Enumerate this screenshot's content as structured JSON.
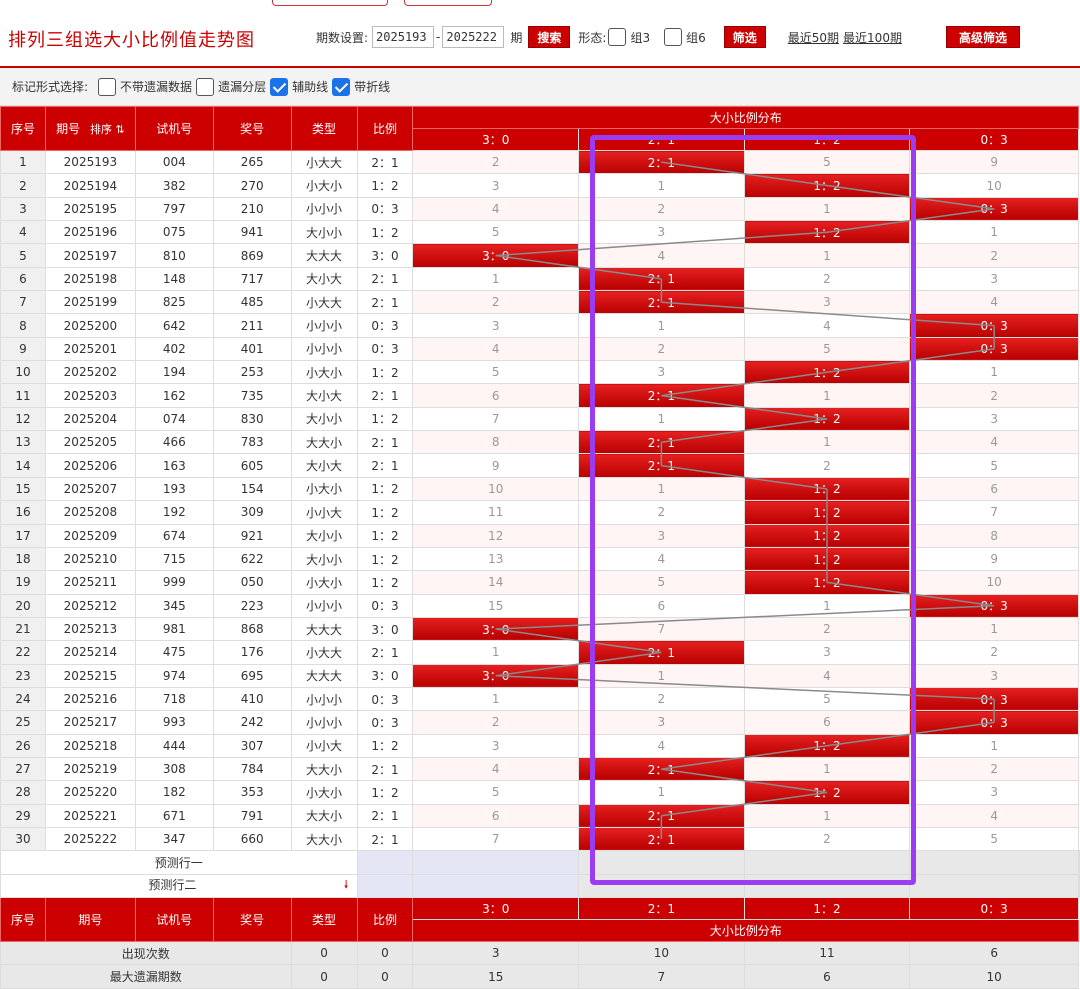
{
  "header": {
    "title": "排列三组选大小比例值走势图",
    "period_label": "期数设置:",
    "period_from": "2025193",
    "period_to": "2025222",
    "period_suffix": "期",
    "search_label": "搜索",
    "form_label": "形态:",
    "group3_label": "组3",
    "group6_label": "组6",
    "filter_label": "筛选",
    "recent50": "最近50期",
    "recent100": "最近100期",
    "advanced_label": "高级筛选"
  },
  "markers": {
    "label": "标记形式选择:",
    "options": [
      {
        "label": "不带遗漏数据",
        "checked": false
      },
      {
        "label": "遗漏分层",
        "checked": false
      },
      {
        "label": "辅助线",
        "checked": true
      },
      {
        "label": "带折线",
        "checked": true
      }
    ]
  },
  "columns": {
    "idx": "序号",
    "period": "期号",
    "sort": "排序",
    "test": "试机号",
    "prize": "奖号",
    "type": "类型",
    "ratio": "比例",
    "dist_title": "大小比例分布",
    "dist": [
      "3：0",
      "2：1",
      "1：2",
      "0：3"
    ]
  },
  "rows": [
    {
      "idx": "1",
      "period": "2025193",
      "test": "004",
      "prize": "265",
      "type": "小大大",
      "ratio": "2：1",
      "dist": [
        "2",
        "2：1",
        "5",
        "9"
      ]
    },
    {
      "idx": "2",
      "period": "2025194",
      "test": "382",
      "prize": "270",
      "type": "小大小",
      "ratio": "1：2",
      "dist": [
        "3",
        "1",
        "1：2",
        "10"
      ]
    },
    {
      "idx": "3",
      "period": "2025195",
      "test": "797",
      "prize": "210",
      "type": "小小小",
      "ratio": "0：3",
      "dist": [
        "4",
        "2",
        "1",
        "0：3"
      ]
    },
    {
      "idx": "4",
      "period": "2025196",
      "test": "075",
      "prize": "941",
      "type": "大小小",
      "ratio": "1：2",
      "dist": [
        "5",
        "3",
        "1：2",
        "1"
      ]
    },
    {
      "idx": "5",
      "period": "2025197",
      "test": "810",
      "prize": "869",
      "type": "大大大",
      "ratio": "3：0",
      "dist": [
        "3：0",
        "4",
        "1",
        "2"
      ]
    },
    {
      "idx": "6",
      "period": "2025198",
      "test": "148",
      "prize": "717",
      "type": "大小大",
      "ratio": "2：1",
      "dist": [
        "1",
        "2：1",
        "2",
        "3"
      ]
    },
    {
      "idx": "7",
      "period": "2025199",
      "test": "825",
      "prize": "485",
      "type": "小大大",
      "ratio": "2：1",
      "dist": [
        "2",
        "2：1",
        "3",
        "4"
      ]
    },
    {
      "idx": "8",
      "period": "2025200",
      "test": "642",
      "prize": "211",
      "type": "小小小",
      "ratio": "0：3",
      "dist": [
        "3",
        "1",
        "4",
        "0：3"
      ]
    },
    {
      "idx": "9",
      "period": "2025201",
      "test": "402",
      "prize": "401",
      "type": "小小小",
      "ratio": "0：3",
      "dist": [
        "4",
        "2",
        "5",
        "0：3"
      ]
    },
    {
      "idx": "10",
      "period": "2025202",
      "test": "194",
      "prize": "253",
      "type": "小大小",
      "ratio": "1：2",
      "dist": [
        "5",
        "3",
        "1：2",
        "1"
      ]
    },
    {
      "idx": "11",
      "period": "2025203",
      "test": "162",
      "prize": "735",
      "type": "大小大",
      "ratio": "2：1",
      "dist": [
        "6",
        "2：1",
        "1",
        "2"
      ]
    },
    {
      "idx": "12",
      "period": "2025204",
      "test": "074",
      "prize": "830",
      "type": "大小小",
      "ratio": "1：2",
      "dist": [
        "7",
        "1",
        "1：2",
        "3"
      ]
    },
    {
      "idx": "13",
      "period": "2025205",
      "test": "466",
      "prize": "783",
      "type": "大大小",
      "ratio": "2：1",
      "dist": [
        "8",
        "2：1",
        "1",
        "4"
      ]
    },
    {
      "idx": "14",
      "period": "2025206",
      "test": "163",
      "prize": "605",
      "type": "大小大",
      "ratio": "2：1",
      "dist": [
        "9",
        "2：1",
        "2",
        "5"
      ]
    },
    {
      "idx": "15",
      "period": "2025207",
      "test": "193",
      "prize": "154",
      "type": "小大小",
      "ratio": "1：2",
      "dist": [
        "10",
        "1",
        "1：2",
        "6"
      ]
    },
    {
      "idx": "16",
      "period": "2025208",
      "test": "192",
      "prize": "309",
      "type": "小小大",
      "ratio": "1：2",
      "dist": [
        "11",
        "2",
        "1：2",
        "7"
      ]
    },
    {
      "idx": "17",
      "period": "2025209",
      "test": "674",
      "prize": "921",
      "type": "大小小",
      "ratio": "1：2",
      "dist": [
        "12",
        "3",
        "1：2",
        "8"
      ]
    },
    {
      "idx": "18",
      "period": "2025210",
      "test": "715",
      "prize": "622",
      "type": "大小小",
      "ratio": "1：2",
      "dist": [
        "13",
        "4",
        "1：2",
        "9"
      ]
    },
    {
      "idx": "19",
      "period": "2025211",
      "test": "999",
      "prize": "050",
      "type": "小大小",
      "ratio": "1：2",
      "dist": [
        "14",
        "5",
        "1：2",
        "10"
      ]
    },
    {
      "idx": "20",
      "period": "2025212",
      "test": "345",
      "prize": "223",
      "type": "小小小",
      "ratio": "0：3",
      "dist": [
        "15",
        "6",
        "1",
        "0：3"
      ]
    },
    {
      "idx": "21",
      "period": "2025213",
      "test": "981",
      "prize": "868",
      "type": "大大大",
      "ratio": "3：0",
      "dist": [
        "3：0",
        "7",
        "2",
        "1"
      ]
    },
    {
      "idx": "22",
      "period": "2025214",
      "test": "475",
      "prize": "176",
      "type": "小大大",
      "ratio": "2：1",
      "dist": [
        "1",
        "2：1",
        "3",
        "2"
      ]
    },
    {
      "idx": "23",
      "period": "2025215",
      "test": "974",
      "prize": "695",
      "type": "大大大",
      "ratio": "3：0",
      "dist": [
        "3：0",
        "1",
        "4",
        "3"
      ]
    },
    {
      "idx": "24",
      "period": "2025216",
      "test": "718",
      "prize": "410",
      "type": "小小小",
      "ratio": "0：3",
      "dist": [
        "1",
        "2",
        "5",
        "0：3"
      ]
    },
    {
      "idx": "25",
      "period": "2025217",
      "test": "993",
      "prize": "242",
      "type": "小小小",
      "ratio": "0：3",
      "dist": [
        "2",
        "3",
        "6",
        "0：3"
      ]
    },
    {
      "idx": "26",
      "period": "2025218",
      "test": "444",
      "prize": "307",
      "type": "小小大",
      "ratio": "1：2",
      "dist": [
        "3",
        "4",
        "1：2",
        "1"
      ]
    },
    {
      "idx": "27",
      "period": "2025219",
      "test": "308",
      "prize": "784",
      "type": "大大小",
      "ratio": "2：1",
      "dist": [
        "4",
        "2：1",
        "1",
        "2"
      ]
    },
    {
      "idx": "28",
      "period": "2025220",
      "test": "182",
      "prize": "353",
      "type": "小大小",
      "ratio": "1：2",
      "dist": [
        "5",
        "1",
        "1：2",
        "3"
      ]
    },
    {
      "idx": "29",
      "period": "2025221",
      "test": "671",
      "prize": "791",
      "type": "大大小",
      "ratio": "2：1",
      "dist": [
        "6",
        "2：1",
        "1",
        "4"
      ]
    },
    {
      "idx": "30",
      "period": "2025222",
      "test": "347",
      "prize": "660",
      "type": "大大小",
      "ratio": "2：1",
      "dist": [
        "7",
        "2：1",
        "2",
        "5"
      ]
    }
  ],
  "predict": [
    "预测行一",
    "预测行二"
  ],
  "stats": [
    {
      "label": "出现次数",
      "type": "0",
      "ratio": "0",
      "dist": [
        "3",
        "10",
        "11",
        "6"
      ]
    },
    {
      "label": "最大遗漏期数",
      "type": "0",
      "ratio": "0",
      "dist": [
        "15",
        "7",
        "6",
        "10"
      ]
    }
  ],
  "colors": {
    "accent": "#cc0000",
    "highlight_box": "#9b3cf0",
    "check": "#1a73e8"
  }
}
